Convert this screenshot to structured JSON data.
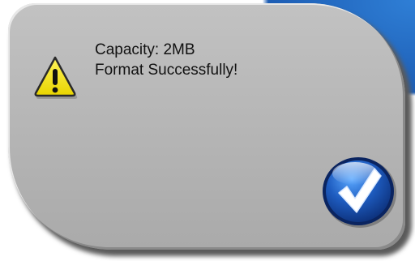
{
  "dialog": {
    "message_lines": [
      "Capacity: 2MB",
      "Format Successfully!"
    ],
    "icon": "warning-triangle-icon",
    "confirm_icon": "checkmark-icon"
  },
  "colors": {
    "dialog_bg": "#b3b3b3",
    "warning_yellow": "#f6e600",
    "button_blue": "#1e5cc0",
    "backdrop_blue": "#1d5db4"
  }
}
